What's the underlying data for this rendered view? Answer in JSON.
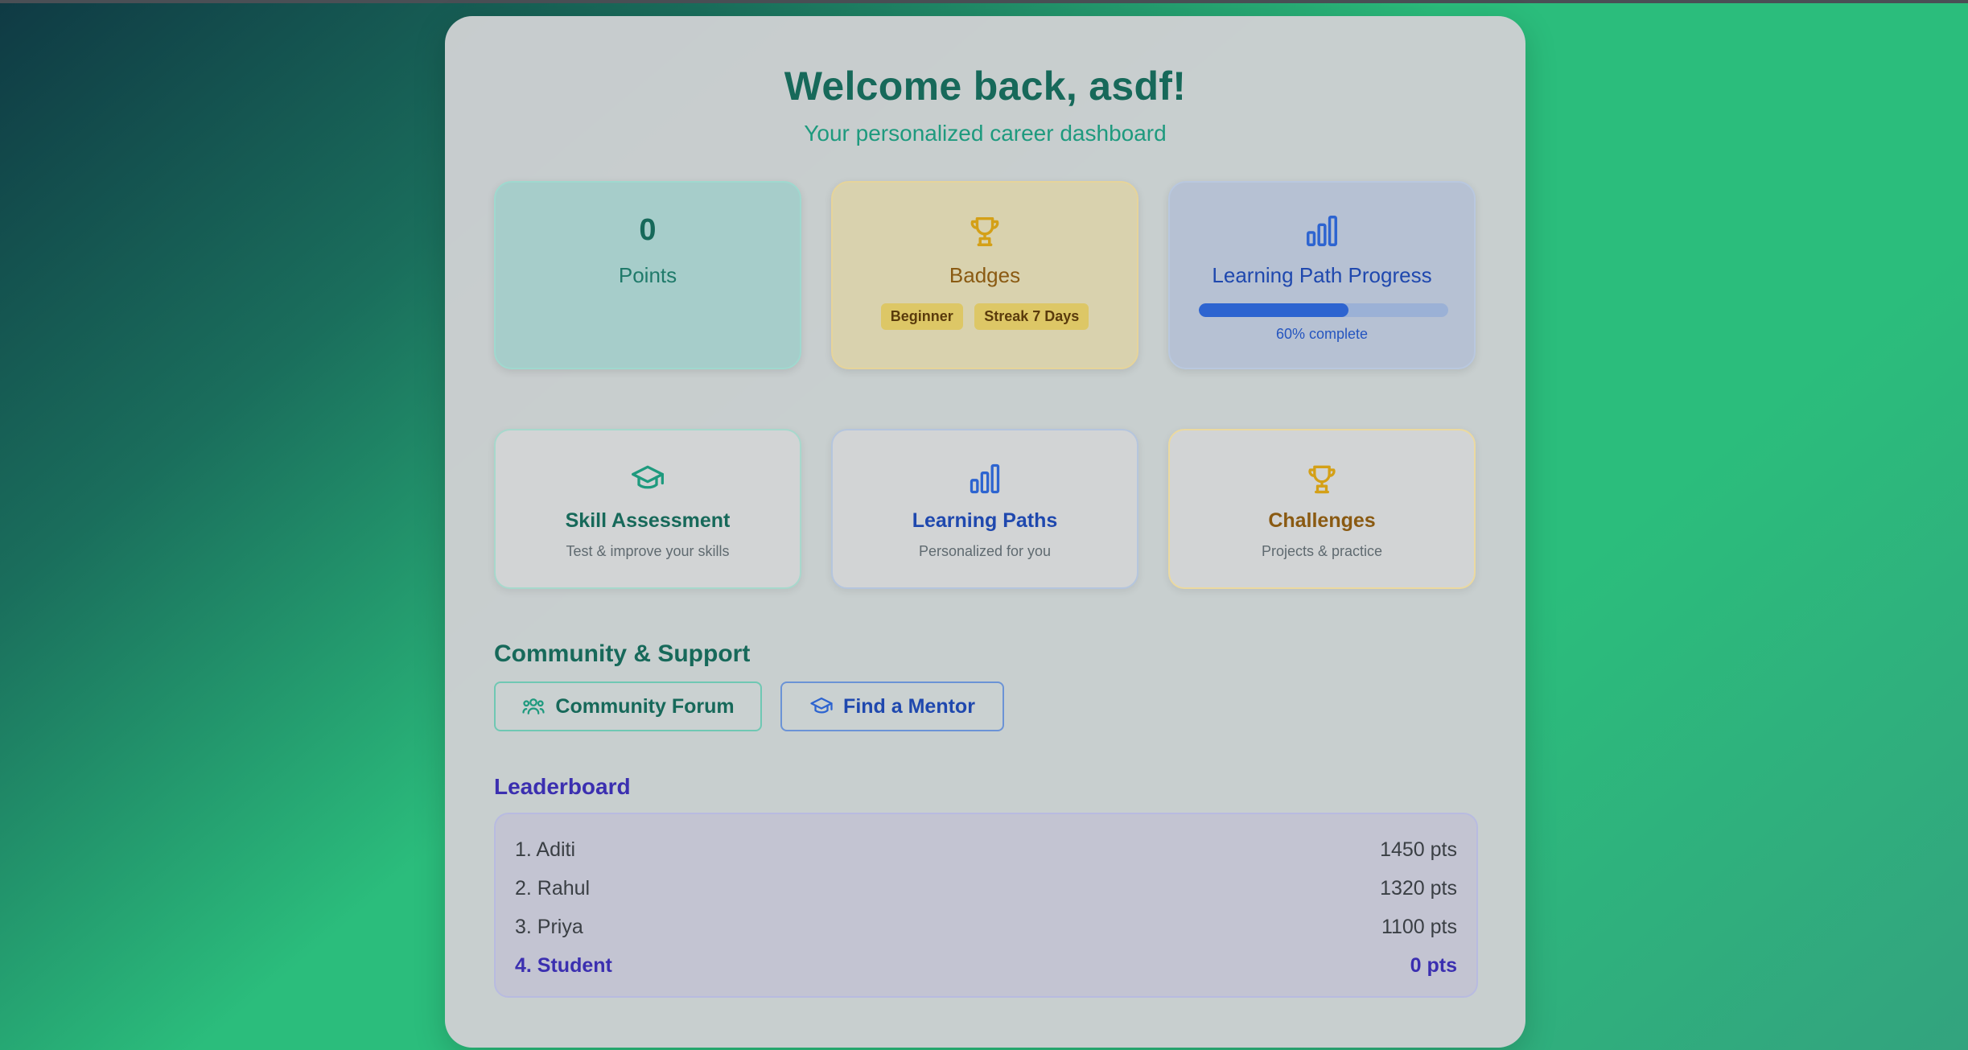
{
  "header": {
    "title": "Welcome back, asdf!",
    "subtitle": "Your personalized career dashboard"
  },
  "stats": {
    "points": {
      "value": "0",
      "label": "Points"
    },
    "badges": {
      "label": "Badges",
      "items": [
        "Beginner",
        "Streak 7 Days"
      ]
    },
    "progress": {
      "label": "Learning Path Progress",
      "fraction": 0.6,
      "text": "60% complete"
    }
  },
  "features": [
    {
      "title": "Skill Assessment",
      "subtitle": "Test & improve your skills",
      "icon": "graduation-cap-icon"
    },
    {
      "title": "Learning Paths",
      "subtitle": "Personalized for you",
      "icon": "bar-chart-icon"
    },
    {
      "title": "Challenges",
      "subtitle": "Projects & practice",
      "icon": "trophy-icon"
    }
  ],
  "community": {
    "title": "Community & Support",
    "forum_label": "Community Forum",
    "mentor_label": "Find a Mentor"
  },
  "leaderboard": {
    "title": "Leaderboard",
    "rows": [
      {
        "name": "1. Aditi",
        "points": "1450 pts"
      },
      {
        "name": "2. Rahul",
        "points": "1320 pts"
      },
      {
        "name": "3. Priya",
        "points": "1100 pts"
      },
      {
        "name": "4. Student",
        "points": "0 pts"
      }
    ]
  },
  "colors": {
    "teal": "#17695a",
    "gold": "#d4a017",
    "blue": "#2d64d0",
    "indigo": "#3b2fb0"
  }
}
